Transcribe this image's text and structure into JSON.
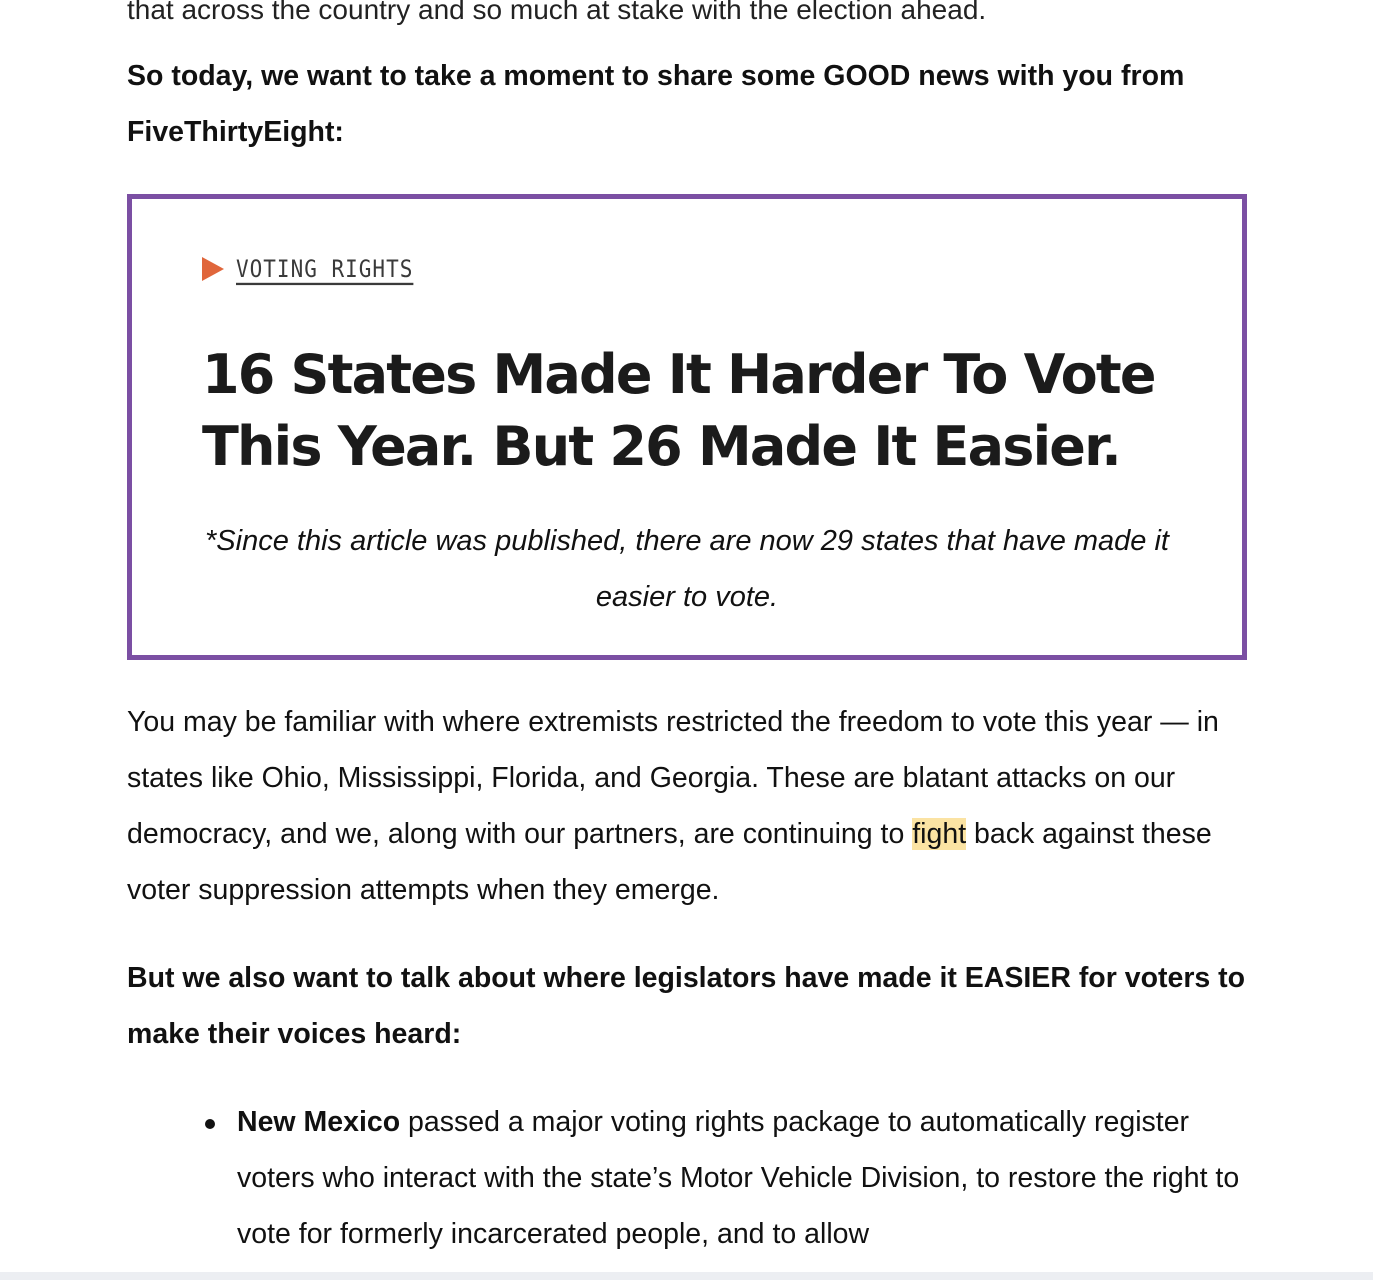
{
  "top_cutoff_text": "that across the country and so much at stake with the election ahead.",
  "intro": "So today, we want to take a moment to share some GOOD news with you from FiveThirtyEight:",
  "article": {
    "kicker": "VOTING RIGHTS",
    "headline": "16 States Made It Harder To Vote This Year. But 26 Made It Easier.",
    "note": "*Since this article was published, there are now 29 states that have made it easier to vote."
  },
  "body1": {
    "before_highlight": "You may be familiar with where extremists restricted the freedom to vote this year — in states like Ohio, Mississippi, Florida, and Georgia. These are blatant attacks on our democracy, and we, along with our partners, are continuing to ",
    "highlight": "fight",
    "after_highlight": " back against these voter suppression attempts when they emerge."
  },
  "body2": "But we also want to talk about where legislators have made it EASIER for voters to make their voices heard:",
  "bullets": [
    {
      "bold": "New Mexico",
      "text": " passed a major voting rights package to automatically register voters who interact with the state’s Motor Vehicle Division, to restore the right to vote for formerly incarcerated people, and to allow"
    }
  ],
  "colors": {
    "box_border": "#7b4fa3",
    "kicker_arrow": "#e0663b",
    "highlight": "#fbe3a3"
  }
}
